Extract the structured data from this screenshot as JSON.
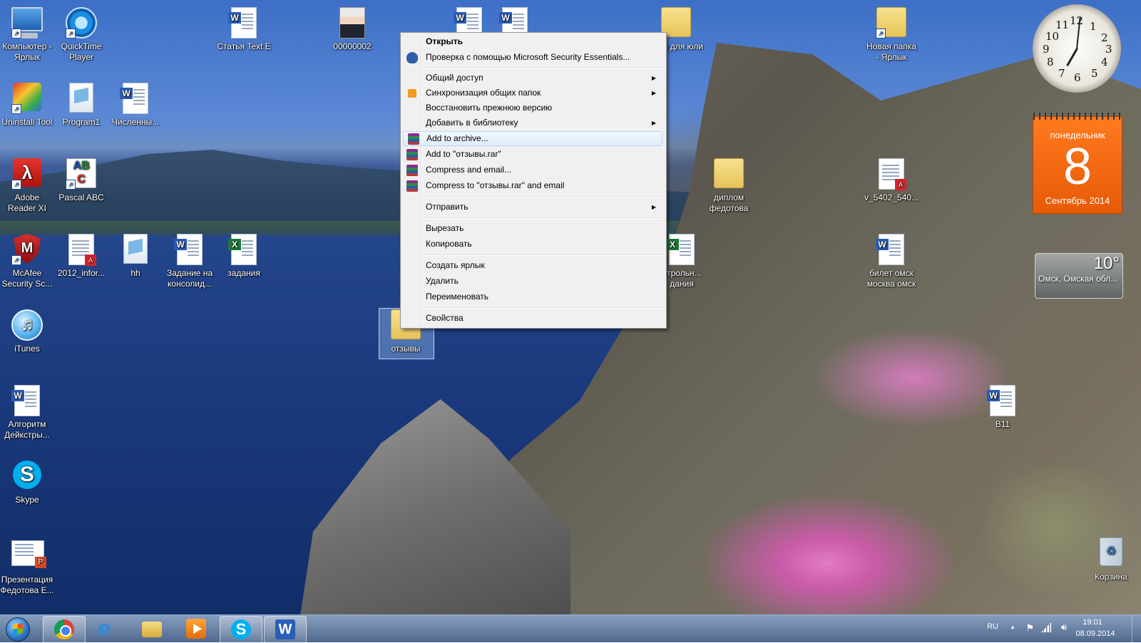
{
  "desktop_icons": [
    {
      "id": "computer",
      "label": "Компьютер - Ярлык",
      "kind": "computer"
    },
    {
      "id": "quicktime",
      "label": "QuickTime Player",
      "kind": "quicktime"
    },
    {
      "id": "statya",
      "label": "Статья Text E",
      "kind": "word"
    },
    {
      "id": "photo",
      "label": "00000002",
      "kind": "photo"
    },
    {
      "id": "zadachi",
      "label": "дачи для юли",
      "kind": "folder"
    },
    {
      "id": "novaya",
      "label": "Новая папка - Ярлык",
      "kind": "folder"
    },
    {
      "id": "uninstall",
      "label": "Uninstall Tool",
      "kind": "uninstall"
    },
    {
      "id": "program1",
      "label": "Program1",
      "kind": "program"
    },
    {
      "id": "chislennye",
      "label": "Численны...",
      "kind": "word"
    },
    {
      "id": "adobe",
      "label": "Adobe Reader XI",
      "kind": "adobe"
    },
    {
      "id": "pascal",
      "label": "Pascal ABC",
      "kind": "pascal"
    },
    {
      "id": "diplom",
      "label": "диплом федотова",
      "kind": "folder"
    },
    {
      "id": "pdf5402",
      "label": "v_5402_540...",
      "kind": "pdfdoc"
    },
    {
      "id": "mcafee",
      "label": "McAfee Security Sc...",
      "kind": "mcafee"
    },
    {
      "id": "info2012",
      "label": "2012_infor...",
      "kind": "pdfdoc"
    },
    {
      "id": "hh",
      "label": "hh",
      "kind": "program"
    },
    {
      "id": "zadanie",
      "label": "Задание на консолид...",
      "kind": "word"
    },
    {
      "id": "zadaniya",
      "label": "задания",
      "kind": "excel"
    },
    {
      "id": "kontrol",
      "label": "нтрольн... дания",
      "kind": "excel"
    },
    {
      "id": "bilet",
      "label": "билет омск москва омск",
      "kind": "word"
    },
    {
      "id": "itunes",
      "label": "iTunes",
      "kind": "itunes"
    },
    {
      "id": "otzyvy",
      "label": "отзывы",
      "kind": "folder"
    },
    {
      "id": "algoritm",
      "label": "Алгоритм Дейкстры...",
      "kind": "word"
    },
    {
      "id": "b11",
      "label": "B11",
      "kind": "word"
    },
    {
      "id": "skype",
      "label": "Skype",
      "kind": "skype"
    },
    {
      "id": "prezentaciya",
      "label": "Презентация Федотова Е...",
      "kind": "ppt"
    },
    {
      "id": "korzina",
      "label": "Корзина",
      "kind": "recycle"
    }
  ],
  "context_menu": {
    "items": [
      {
        "label": "Открыть",
        "bold": true,
        "icon": ""
      },
      {
        "label": "Проверка с помощью Microsoft Security Essentials...",
        "icon": "mse-icon"
      },
      {
        "label": "Общий доступ",
        "submenu": true,
        "icon": ""
      },
      {
        "label": "Синхронизация общих папок",
        "submenu": true,
        "icon": "sync-icon"
      },
      {
        "label": "Восстановить прежнюю версию",
        "icon": ""
      },
      {
        "label": "Добавить в библиотеку",
        "submenu": true,
        "icon": ""
      },
      {
        "label": "Add to archive...",
        "icon": "winrar-icon",
        "highlighted": true
      },
      {
        "label": "Add to \"отзывы.rar\"",
        "icon": "winrar-icon"
      },
      {
        "label": "Compress and email...",
        "icon": "winrar-icon"
      },
      {
        "label": "Compress to \"отзывы.rar\" and email",
        "icon": "winrar-icon"
      },
      {
        "label": "Отправить",
        "submenu": true,
        "icon": ""
      },
      {
        "label": "Вырезать",
        "icon": ""
      },
      {
        "label": "Копировать",
        "icon": ""
      },
      {
        "label": "Создать ярлык",
        "icon": ""
      },
      {
        "label": "Удалить",
        "icon": ""
      },
      {
        "label": "Переименовать",
        "icon": ""
      },
      {
        "label": "Свойства",
        "icon": ""
      }
    ],
    "submenu_arrow": "▶"
  },
  "gadgets": {
    "clock": {
      "hour_numbers": [
        "12",
        "1",
        "2",
        "3",
        "4",
        "5",
        "6",
        "7",
        "8",
        "9",
        "10",
        "11"
      ]
    },
    "calendar": {
      "weekday": "понедельник",
      "day": "8",
      "month_year": "Сентябрь 2014"
    },
    "weather": {
      "temperature": "10°",
      "location": "Омск, Омская обл..."
    }
  },
  "taskbar": {
    "apps": [
      {
        "name": "chrome",
        "color": "#dd4b39",
        "active": true
      },
      {
        "name": "internet-explorer",
        "color": "#2a8ce0",
        "active": false
      },
      {
        "name": "file-explorer",
        "color": "#e8c45e",
        "active": false
      },
      {
        "name": "media-player",
        "color": "#f08a1c",
        "active": false
      },
      {
        "name": "skype",
        "color": "#00aff0",
        "active": true
      },
      {
        "name": "word",
        "color": "#2a5eb8",
        "active": true
      }
    ],
    "language": "RU",
    "time": "19:01",
    "date": "08.09.2014",
    "tray_arrow": "▲"
  }
}
